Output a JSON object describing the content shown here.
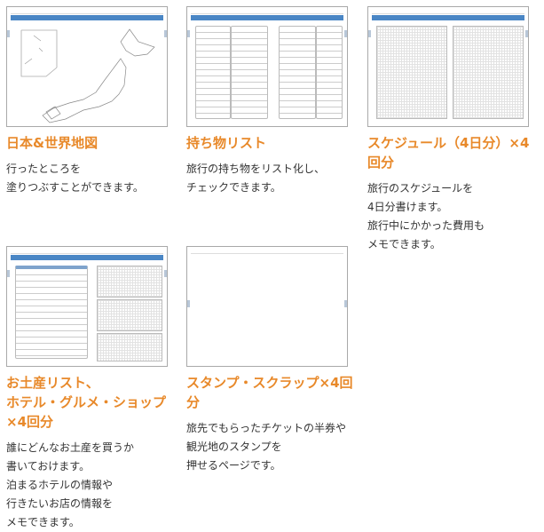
{
  "items": [
    {
      "title_lines": [
        "日本&世界地図"
      ],
      "desc_lines": [
        "行ったところを",
        "塗りつぶすことができます。"
      ]
    },
    {
      "title_lines": [
        "持ち物リスト"
      ],
      "desc_lines": [
        "旅行の持ち物をリスト化し、",
        "チェックできます。"
      ]
    },
    {
      "title_lines": [
        "スケジュール（4日分）×4回分"
      ],
      "desc_lines": [
        "旅行のスケジュールを",
        "4日分書けます。",
        "旅行中にかかった費用も",
        "メモできます。"
      ]
    },
    {
      "title_lines": [
        "お土産リスト、",
        "ホテル・グルメ・ショップ×4回分"
      ],
      "desc_lines": [
        "誰にどんなお土産を買うか",
        "書いておけます。",
        "泊まるホテルの情報や",
        "行きたいお店の情報を",
        "メモできます。"
      ]
    },
    {
      "title_lines": [
        "スタンプ・スクラップ×4回分"
      ],
      "desc_lines": [
        "旅先でもらったチケットの半券や",
        "観光地のスタンプを",
        "押せるページです。"
      ]
    }
  ],
  "colors": {
    "title": "#e8892a",
    "header_bar": "#4a86c5"
  }
}
